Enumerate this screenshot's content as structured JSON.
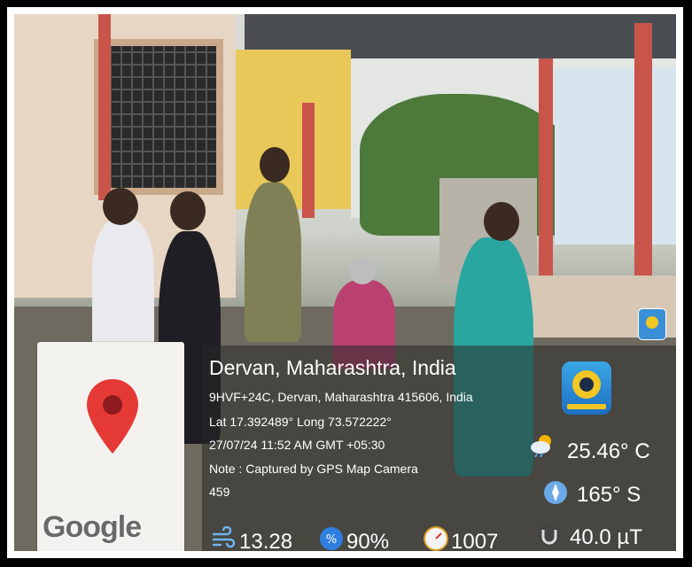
{
  "location": {
    "title": "Dervan, Maharashtra, India",
    "address": "9HVF+24C, Dervan, Maharashtra 415606, India",
    "coords": "Lat 17.392489° Long 73.572222°",
    "datetime": "27/07/24 11:52 AM GMT +05:30",
    "note": "Note : Captured by GPS Map Camera",
    "extra": "459"
  },
  "map": {
    "logo_text": "Google",
    "pin_color": "#e53935"
  },
  "weather": {
    "temperature": "25.46° C",
    "direction": "165° S",
    "magnetic": "40.0 µT",
    "wind": "13.28",
    "humidity": "90%",
    "pressure": "1007"
  },
  "icons": {
    "app": "gps-map-camera-icon",
    "temp": "partly-cloudy-icon",
    "compass": "compass-icon",
    "magnet": "magnetic-field-icon",
    "wind": "wind-icon",
    "humidity": "humidity-icon",
    "pressure": "pressure-gauge-icon"
  }
}
